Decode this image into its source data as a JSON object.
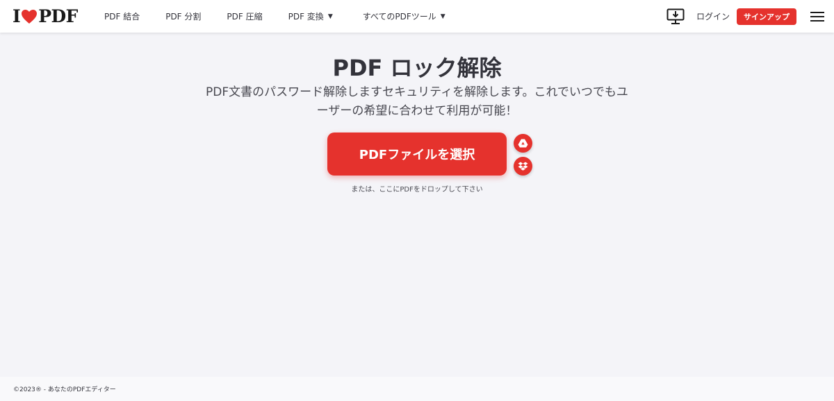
{
  "header": {
    "logo": {
      "prefix": "I",
      "suffix": "PDF",
      "brand_color": "#e5322d"
    },
    "nav": [
      {
        "label": "PDF 結合",
        "dropdown": false
      },
      {
        "label": "PDF 分割",
        "dropdown": false
      },
      {
        "label": "PDF 圧縮",
        "dropdown": false
      },
      {
        "label": "PDF 変換",
        "dropdown": true
      },
      {
        "label": "すべてのPDFツール",
        "dropdown": true
      }
    ],
    "desktop_icon": "desktop-download-icon",
    "login_label": "ログイン",
    "signup_label": "サインアップ",
    "menu_icon": "hamburger-menu-icon"
  },
  "main": {
    "title": "PDF ロック解除",
    "subtitle": "PDF文書のパスワード解除しますセキュリティを解除します。これでいつでもユーザーの希望に合わせて利用が可能！",
    "select_button_label": "PDFファイルを選択",
    "cloud_buttons": [
      "google-drive-icon",
      "dropbox-icon"
    ],
    "drop_hint": "または、ここにPDFをドロップして下さい"
  },
  "footer": {
    "copyright": "©2023® - あなたのPDFエディター"
  },
  "colors": {
    "accent": "#e5322d",
    "background": "#f4f4f8",
    "text": "#33333b"
  }
}
